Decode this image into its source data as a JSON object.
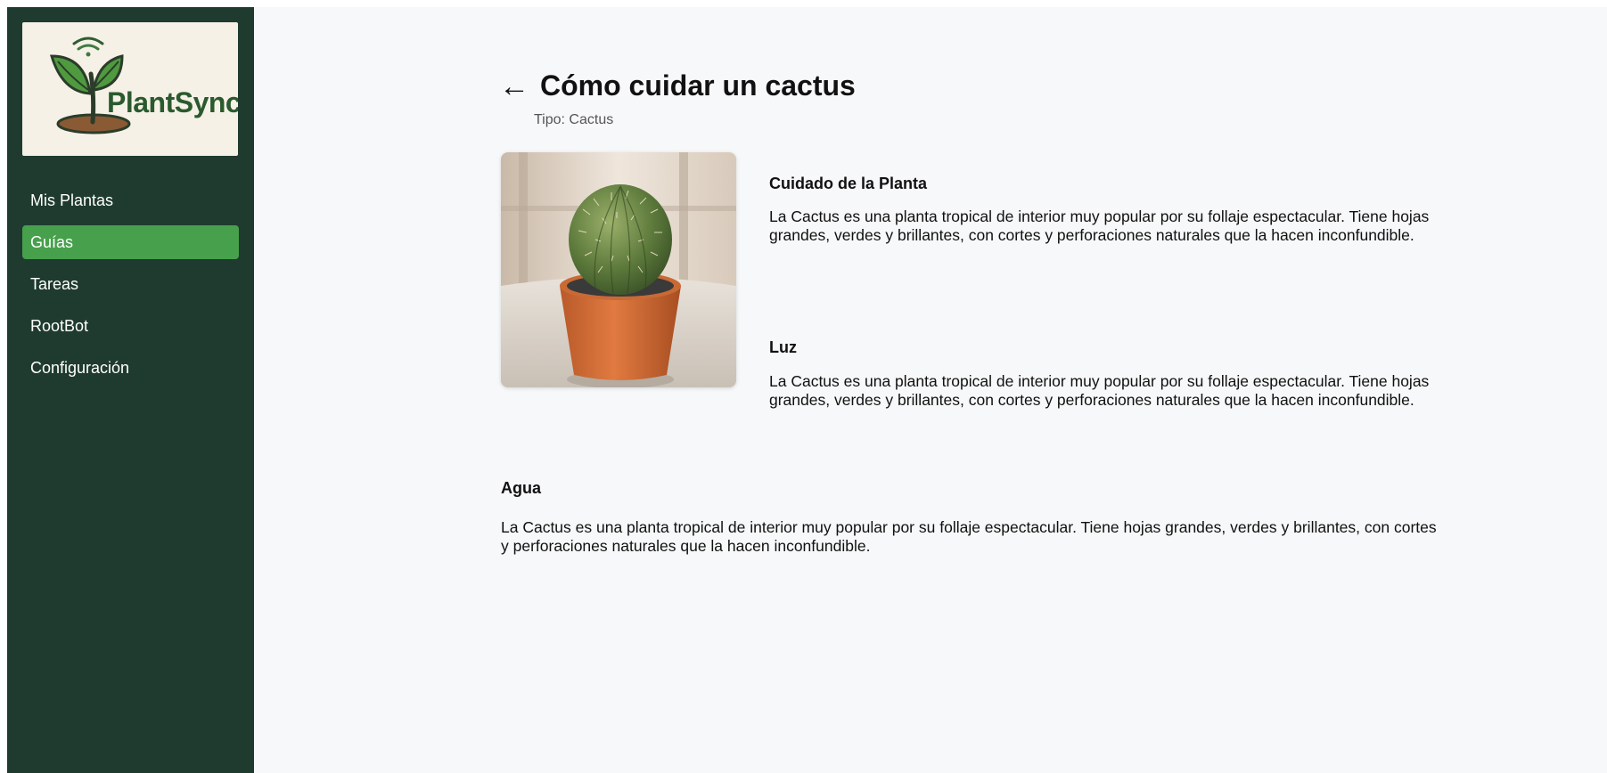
{
  "logo": {
    "brand": "PlantSync"
  },
  "sidebar": {
    "items": [
      {
        "label": "Mis Plantas"
      },
      {
        "label": "Guías"
      },
      {
        "label": "Tareas"
      },
      {
        "label": "RootBot"
      },
      {
        "label": "Configuración"
      }
    ],
    "active_item": "Guías"
  },
  "header": {
    "back_icon": "←",
    "title": "Cómo cuidar un cactus",
    "subtitle": "Tipo: Cactus"
  },
  "sections": {
    "care": {
      "title": "Cuidado de la Planta",
      "text": "La Cactus es una planta tropical de interior muy popular por su follaje espectacular. Tiene hojas grandes, verdes y brillantes, con cortes y perforaciones naturales que la hacen inconfundible."
    },
    "light": {
      "title": "Luz",
      "text": "La Cactus es una planta tropical de interior muy popular por su follaje espectacular. Tiene hojas grandes, verdes y brillantes, con cortes y perforaciones naturales que la hacen inconfundible."
    },
    "water": {
      "title": "Agua",
      "text": "La Cactus es una planta tropical de interior muy popular por su follaje espectacular. Tiene hojas grandes, verdes y brillantes, con cortes y perforaciones naturales que la hacen inconfundible."
    }
  },
  "colors": {
    "sidebar_bg": "#1f3b2f",
    "active_nav": "#47a04c",
    "page_bg": "#f7f8f9",
    "logo_bg": "#f6f1e6"
  }
}
